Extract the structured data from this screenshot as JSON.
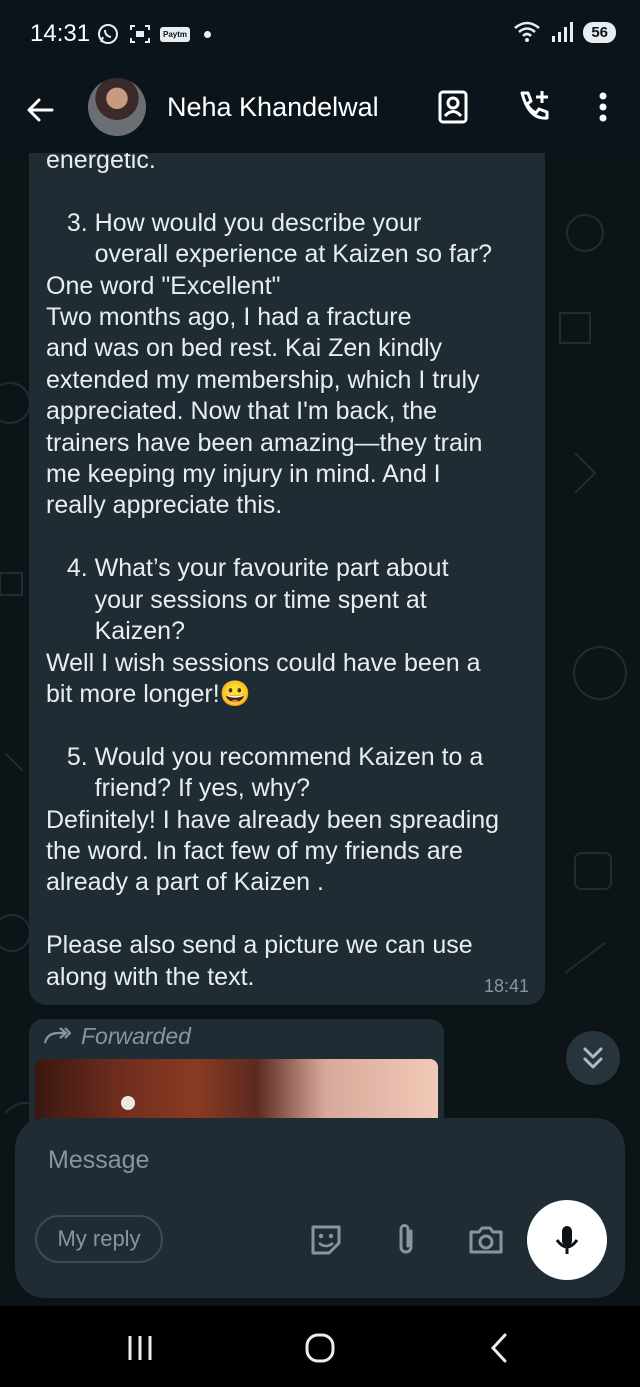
{
  "status_bar": {
    "time": "14:31",
    "paytm": "Paytm",
    "battery": "56"
  },
  "header": {
    "contact_name": "Neha Khandelwal",
    "icons": [
      "back-arrow-icon",
      "contact-card-icon",
      "add-call-icon",
      "more-vert-icon"
    ]
  },
  "message": {
    "text": "energetic.\n\n   3. How would you describe your\n       overall experience at Kaizen so far?\nOne word \"Excellent\"\nTwo months ago, I had a fracture\nand was on bed rest. Kai Zen kindly\nextended my membership, which I truly\nappreciated. Now that I'm back, the\ntrainers have been amazing—they train\nme keeping my injury in mind. And I\nreally appreciate this.\n\n   4. What’s your favourite part about\n       your sessions or time spent at\n       Kaizen?\nWell I wish sessions could have been a\nbit more longer!😀\n\n   5. Would you recommend Kaizen to a\n       friend? If yes, why?\nDefinitely! I have already been spreading\nthe word. In fact few of my friends are\nalready a part of Kaizen .\n\nPlease also send a picture we can use\nalong with the text.",
    "time": "18:41"
  },
  "forwarded": {
    "label": "Forwarded"
  },
  "compose": {
    "placeholder": "Message",
    "reply_chip": "My reply"
  },
  "colors": {
    "background": "#0b141a",
    "bubble": "#202c33",
    "meta_text": "#8696a0"
  }
}
